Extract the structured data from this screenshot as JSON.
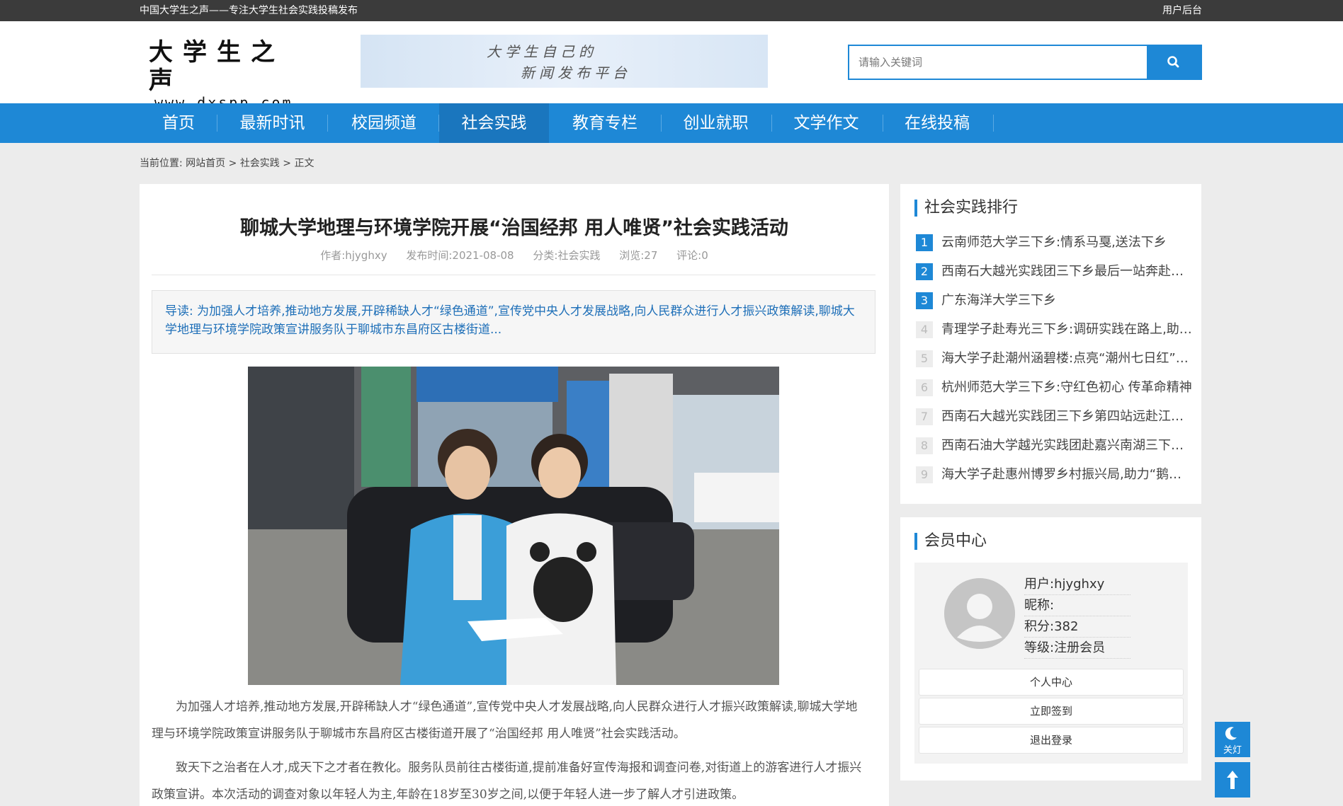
{
  "topbar": {
    "slogan": "中国大学生之声——专注大学生社会实践投稿发布",
    "admin_link": "用户后台"
  },
  "header": {
    "logo_cn": "大学生之声",
    "logo_en": "www.dxspp.com",
    "banner_line1": "大学生自己的",
    "banner_line2": "新闻发布平台",
    "search_placeholder": "请输入关键词",
    "search_icon": "search-icon"
  },
  "nav": {
    "items": [
      {
        "label": "首页"
      },
      {
        "label": "最新时讯"
      },
      {
        "label": "校园频道"
      },
      {
        "label": "社会实践"
      },
      {
        "label": "教育专栏"
      },
      {
        "label": "创业就职"
      },
      {
        "label": "文学作文"
      },
      {
        "label": "在线投稿"
      }
    ],
    "active_index": 3
  },
  "breadcrumb": {
    "prefix": "当前位置:",
    "home": "网站首页",
    "sep": ">",
    "category": "社会实践",
    "current": "正文"
  },
  "article": {
    "title": "聊城大学地理与环境学院开展“治国经邦 用人唯贤”社会实践活动",
    "meta": {
      "author": "作者:hjyghxy",
      "date": "发布时间:2021-08-08",
      "category": "分类:社会实践",
      "views": "浏览:27",
      "comments": "评论:0"
    },
    "lead_label": "导读:",
    "lead_text": "为加强人才培养,推动地方发展,开辟稀缺人才“绿色通道”,宣传党中央人才发展战略,向人民群众进行人才振兴政策解读,聊城大学地理与环境学院政策宣讲服务队于聊城市东昌府区古楼街道...",
    "paragraphs": [
      "为加强人才培养,推动地方发展,开辟稀缺人才“绿色通道”,宣传党中央人才发展战略,向人民群众进行人才振兴政策解读,聊城大学地理与环境学院政策宣讲服务队于聊城市东昌府区古楼街道开展了“治国经邦 用人唯贤”社会实践活动。",
      "致天下之治者在人才,成天下之才者在教化。服务队员前往古楼街道,提前准备好宣传海报和调查问卷,对街道上的游客进行人才振兴政策宣讲。本次活动的调查对象以年轻人为主,年龄在18岁至30岁之间,以便于年轻人进一步了解人才引进政策。"
    ]
  },
  "ranking": {
    "title": "社会实践排行",
    "items": [
      {
        "num": "1",
        "text": "云南师范大学三下乡:情系马戛,送法下乡"
      },
      {
        "num": "2",
        "text": "西南石大越光实践团三下乡最后一站奔赴凉山彝族自治州"
      },
      {
        "num": "3",
        "text": "广东海洋大学三下乡"
      },
      {
        "num": "4",
        "text": "青理学子赴寿光三下乡:调研实践在路上,助力乡村振兴"
      },
      {
        "num": "5",
        "text": "海大学子赴潮州涵碧楼:点亮“潮州七日红”红色记忆"
      },
      {
        "num": "6",
        "text": "杭州师范大学三下乡:守红色初心 传革命精神"
      },
      {
        "num": "7",
        "text": "西南石大越光实践团三下乡第四站远赴江西瑞金"
      },
      {
        "num": "8",
        "text": "西南石油大学越光实践团赴嘉兴南湖三下乡实践活动"
      },
      {
        "num": "9",
        "text": "海大学子赴惠州博罗乡村振兴局,助力“鹅城”发展"
      }
    ]
  },
  "member": {
    "title": "会员中心",
    "user": "用户:hjyghxy",
    "nickname": "昵称:",
    "points": "积分:382",
    "level": "等级:注册会员",
    "btn_center": "个人中心",
    "btn_checkin": "立即签到",
    "btn_logout": "退出登录"
  },
  "floating": {
    "light_label": "关灯",
    "light_icon": "moon-icon",
    "top_icon": "arrow-up-icon"
  },
  "colors": {
    "accent": "#1e88d6",
    "topbar": "#3b3b3b",
    "lead_text": "#1e6fb8"
  }
}
